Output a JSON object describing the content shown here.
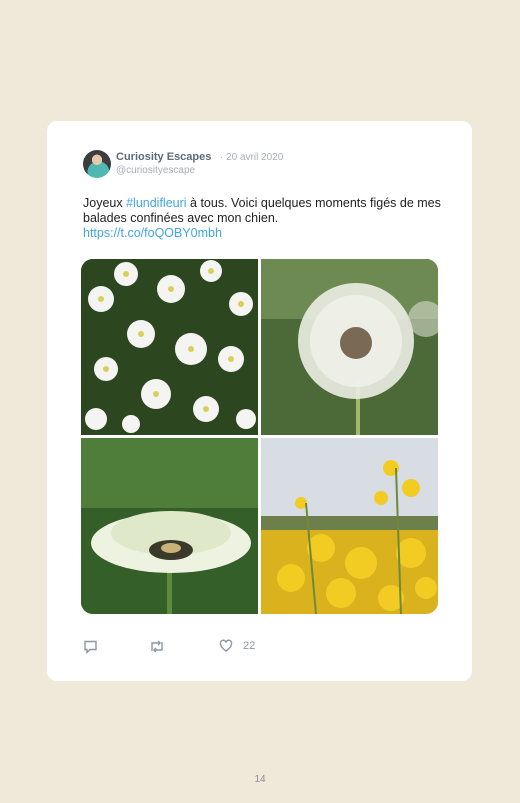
{
  "post": {
    "author": "Curiosity Escapes",
    "date": "· 20 avril 2020",
    "handle": "@curiosityescape",
    "text_before": "Joyeux ",
    "hashtag": "#lundifleuri",
    "text_after": " à tous. Voici quelques moments figés de mes balades confinées avec mon chien.",
    "link": "https://t.co/foQOBY0mbh",
    "photos": [
      "white-stitchwort-flowers",
      "dandelion-seed-head",
      "white-dandelion-flower",
      "yellow-rapeseed-field"
    ]
  },
  "actions": {
    "reply_icon": "reply-icon",
    "retweet_icon": "retweet-icon",
    "like_icon": "heart-icon",
    "like_count": "22"
  },
  "page": {
    "number": "14"
  },
  "colors": {
    "background": "#efe9da",
    "card": "#ffffff",
    "accent": "#3fa6e3",
    "muted": "#a7b0b7"
  }
}
